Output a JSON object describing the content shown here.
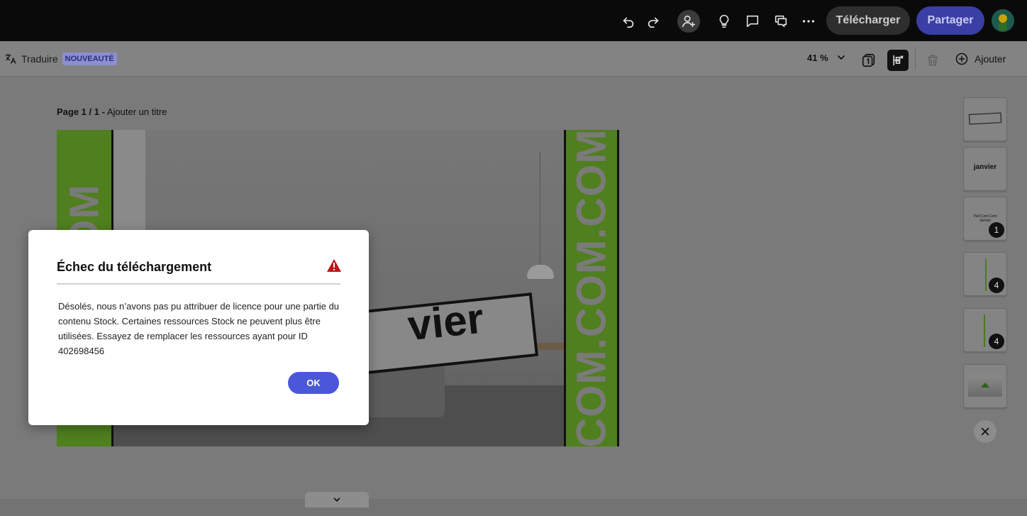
{
  "topbar": {
    "download_label": "Télécharger",
    "share_label": "Partager",
    "icons": [
      "undo-icon",
      "redo-icon",
      "add-person-icon",
      "lightbulb-icon",
      "comment-icon",
      "chat-icon",
      "more-icon"
    ]
  },
  "toolbar": {
    "translate_label": "Traduire",
    "new_badge": "NOUVEAUTÉ",
    "zoom_label": "41 %",
    "add_label": "Ajouter"
  },
  "page": {
    "label_prefix": "Page 1 / 1 -",
    "title_placeholder": "Ajouter un titre"
  },
  "design": {
    "left_strip_text": "COM.COM",
    "right_strip_text": "COM.COM.COM",
    "banner_text": "vier",
    "brand_green": "#79c52b"
  },
  "thumbnails": [
    {
      "badge": ""
    },
    {
      "badge": "",
      "text": "janvier"
    },
    {
      "badge": "1",
      "text": "Perf.Com.Com Janvier"
    },
    {
      "badge": "4"
    },
    {
      "badge": "4"
    },
    {
      "badge": ""
    }
  ],
  "dialog": {
    "title": "Échec du téléchargement",
    "body": "Désolés, nous n’avons pas pu attribuer de licence pour une partie du contenu Stock. Certaines ressources Stock ne peuvent plus être utilisées. Essayez de remplacer les ressources ayant pour ID 402698456",
    "ok_label": "OK",
    "warning_color": "#c0141a",
    "ok_color": "#4b57d8"
  }
}
